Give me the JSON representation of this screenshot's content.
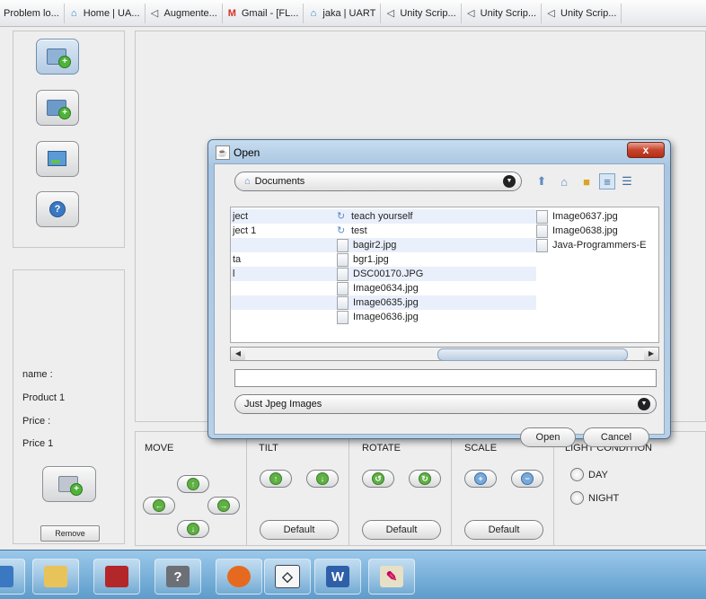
{
  "bookmarks": [
    {
      "label": "Problem lo...",
      "icon": "none"
    },
    {
      "label": "Home | UA...",
      "icon": "home-icon"
    },
    {
      "label": "Augmente...",
      "icon": "unity-icon"
    },
    {
      "label": "Gmail - [FL...",
      "icon": "gmail-icon"
    },
    {
      "label": "jaka | UART",
      "icon": "home-icon"
    },
    {
      "label": "Unity Scrip...",
      "icon": "unity-icon"
    },
    {
      "label": "Unity Scrip...",
      "icon": "unity-icon"
    },
    {
      "label": "Unity Scrip...",
      "icon": "unity-icon"
    }
  ],
  "left_panel": {
    "name_label": "name :",
    "name_value": "Product 1",
    "price_label": "Price :",
    "price_value": "Price 1",
    "remove_label": "Remove"
  },
  "controls": {
    "move_label": "MOVE",
    "tilt_label": "TILT",
    "rotate_label": "ROTATE",
    "scale_label": "SCALE",
    "light_label": "LIGHT CONDITION",
    "default_label": "Default",
    "day_label": "DAY",
    "night_label": "NIGHT"
  },
  "dialog": {
    "title": "Open",
    "close_label": "x",
    "look_in": "Documents",
    "files_col1": [
      "ject",
      "ject 1",
      "",
      "ta",
      "l",
      "",
      "",
      ""
    ],
    "files_col2": [
      {
        "name": "teach yourself",
        "type": "folder"
      },
      {
        "name": "test",
        "type": "folder"
      },
      {
        "name": "bagir2.jpg",
        "type": "file"
      },
      {
        "name": "bgr1.jpg",
        "type": "file"
      },
      {
        "name": "DSC00170.JPG",
        "type": "file"
      },
      {
        "name": "Image0634.jpg",
        "type": "file"
      },
      {
        "name": "Image0635.jpg",
        "type": "file"
      },
      {
        "name": "Image0636.jpg",
        "type": "file"
      }
    ],
    "files_col3": [
      {
        "name": "Image0637.jpg",
        "type": "file"
      },
      {
        "name": "Image0638.jpg",
        "type": "file"
      },
      {
        "name": "Java-Programmers-E",
        "type": "file"
      }
    ],
    "file_name_value": "",
    "filter": "Just Jpeg Images",
    "open_label": "Open",
    "cancel_label": "Cancel"
  },
  "colors": {
    "dialog_frame": "#b8d0e7",
    "close_button": "#c7442c",
    "taskbar": "#5d9ccb",
    "selection": "#e9f0fb"
  }
}
